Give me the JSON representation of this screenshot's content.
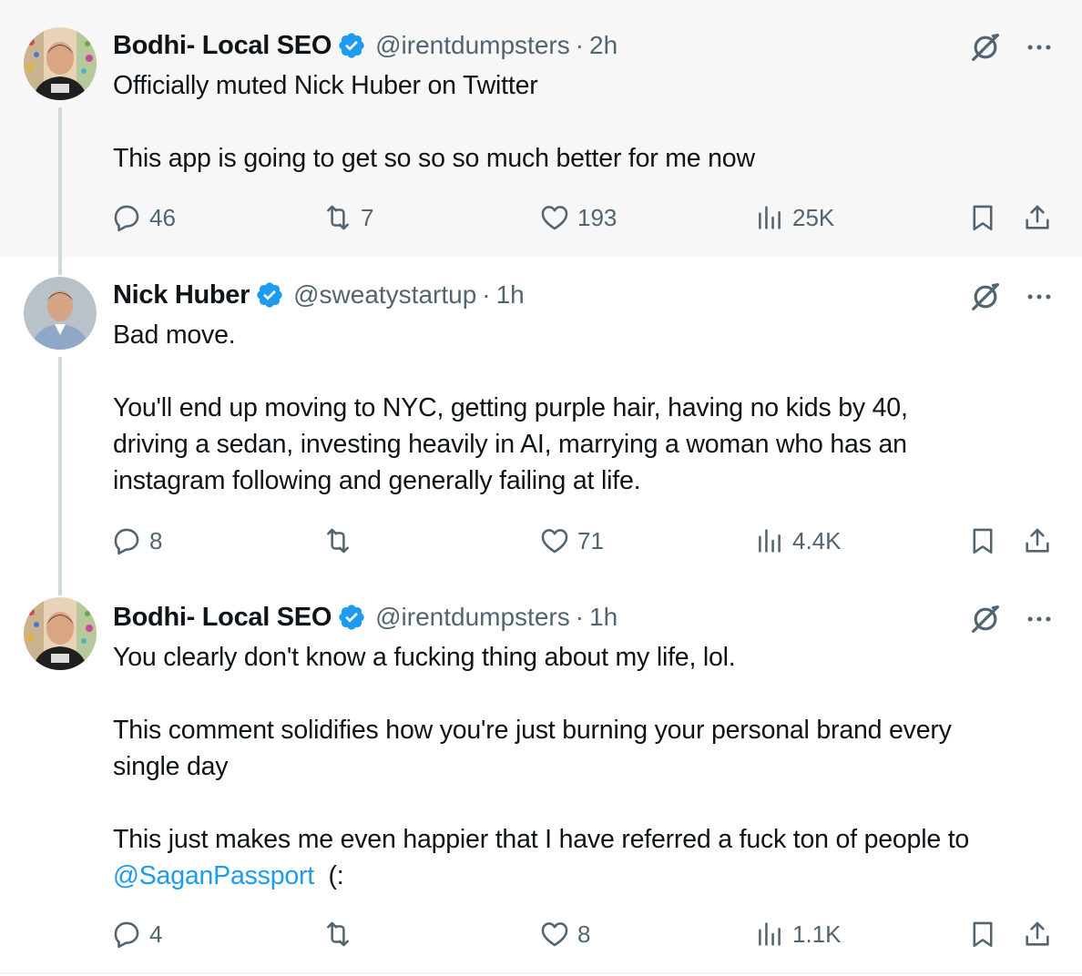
{
  "tweets": [
    {
      "name": "Bodhi- Local SEO",
      "handle": "@irentdumpsters",
      "separator": "·",
      "time": "2h",
      "lines": [
        "Officially muted Nick Huber on Twitter",
        "",
        "This app is going to get so so so much better for me now"
      ],
      "replies": "46",
      "reposts": "7",
      "likes": "193",
      "views": "25K"
    },
    {
      "name": "Nick Huber",
      "handle": "@sweatystartup",
      "separator": "·",
      "time": "1h",
      "lines": [
        "Bad move.",
        "",
        "You'll end up moving to NYC, getting purple hair, having no kids by 40,",
        "driving a sedan, investing heavily in AI, marrying a woman who has an",
        "instagram following and generally failing at life."
      ],
      "replies": "8",
      "reposts": "",
      "likes": "71",
      "views": "4.4K"
    },
    {
      "name": "Bodhi- Local SEO",
      "handle": "@irentdumpsters",
      "separator": "·",
      "time": "1h",
      "line1": "You clearly don't know a fucking thing about my life, lol.",
      "line2": "This comment solidifies how you're just burning your personal brand every",
      "line3": "single day",
      "line4": "This just makes me even happier that I have referred a fuck ton of people to",
      "mention": "@SaganPassport",
      "after_mention": "  (:",
      "replies": "4",
      "reposts": "",
      "likes": "8",
      "views": "1.1K"
    }
  ],
  "colors": {
    "verified": "#1d9bf0",
    "secondary_text": "#536471",
    "thread_line": "#cfd9de",
    "highlight_bg": "#f7f7f7",
    "mention": "#1d9bf0"
  },
  "icons": [
    "verified-badge-icon",
    "grok-icon",
    "more-icon",
    "reply-icon",
    "repost-icon",
    "like-icon",
    "views-icon",
    "bookmark-icon",
    "share-icon"
  ]
}
